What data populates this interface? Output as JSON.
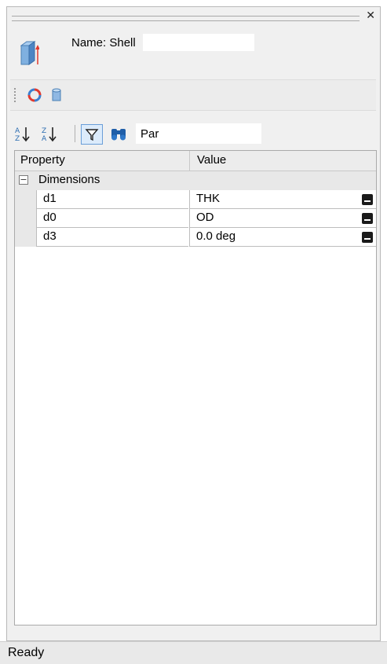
{
  "panel": {
    "name_label": "Name: Shell",
    "search_value": "Par"
  },
  "icons": {
    "close": "close-icon",
    "part": "part-icon",
    "refresh": "refresh-icon",
    "cylinder": "cylinder-icon",
    "sort_az": "sort-az-icon",
    "sort_za": "sort-za-icon",
    "filter": "filter-icon",
    "find": "binoculars-icon"
  },
  "grid": {
    "columns": [
      "Property",
      "Value"
    ],
    "category": "Dimensions",
    "rows": [
      {
        "property": "d1",
        "value": "THK"
      },
      {
        "property": "d0",
        "value": "OD"
      },
      {
        "property": "d3",
        "value": "0.0 deg"
      }
    ]
  },
  "status": {
    "text": "Ready"
  },
  "colors": {
    "panel_bg": "#f0f0f0",
    "filter_highlight": "#dcebfb",
    "refresh_red": "#e03a2f",
    "part_blue": "#5b9bd5"
  }
}
